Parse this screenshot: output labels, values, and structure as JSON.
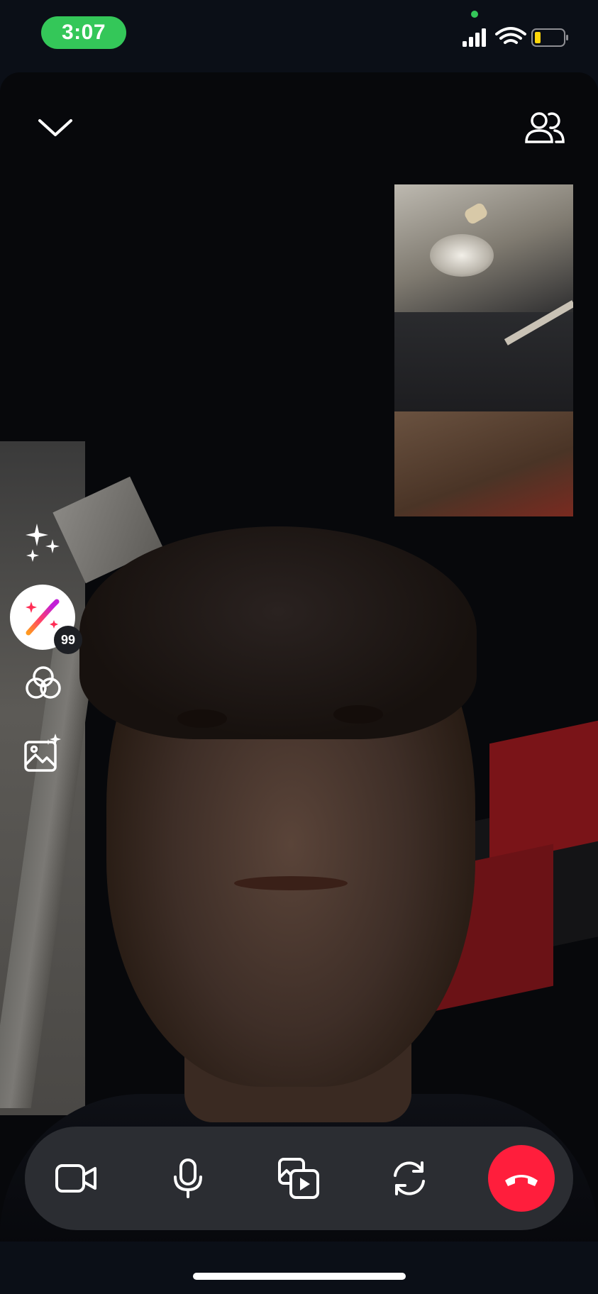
{
  "status_bar": {
    "time": "3:07",
    "battery_level": 0.2,
    "pill_color": "#34c759"
  },
  "call": {
    "remote_badge_count": "99",
    "end_call_color": "#ff1e3c"
  },
  "icons": {
    "collapse": "chevron-down-icon",
    "participants": "participants-icon",
    "effects": "sparkle-icon",
    "wand": "magic-wand-icon",
    "filters": "filters-icon",
    "gallery": "gallery-icon",
    "video": "video-camera-icon",
    "mic": "microphone-icon",
    "share": "media-share-icon",
    "flip": "flip-camera-icon",
    "end": "end-call-icon"
  }
}
